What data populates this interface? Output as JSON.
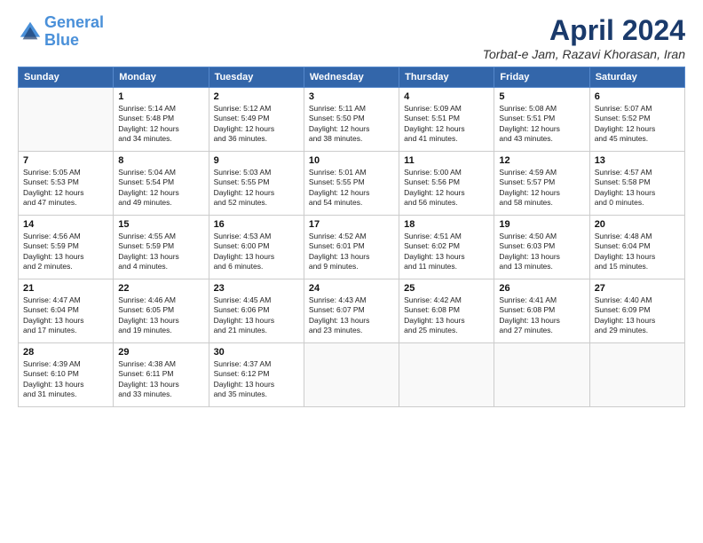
{
  "header": {
    "logo_line1": "General",
    "logo_line2": "Blue",
    "main_title": "April 2024",
    "subtitle": "Torbat-e Jam, Razavi Khorasan, Iran"
  },
  "weekdays": [
    "Sunday",
    "Monday",
    "Tuesday",
    "Wednesday",
    "Thursday",
    "Friday",
    "Saturday"
  ],
  "weeks": [
    [
      {
        "day": "",
        "info": ""
      },
      {
        "day": "1",
        "info": "Sunrise: 5:14 AM\nSunset: 5:48 PM\nDaylight: 12 hours\nand 34 minutes."
      },
      {
        "day": "2",
        "info": "Sunrise: 5:12 AM\nSunset: 5:49 PM\nDaylight: 12 hours\nand 36 minutes."
      },
      {
        "day": "3",
        "info": "Sunrise: 5:11 AM\nSunset: 5:50 PM\nDaylight: 12 hours\nand 38 minutes."
      },
      {
        "day": "4",
        "info": "Sunrise: 5:09 AM\nSunset: 5:51 PM\nDaylight: 12 hours\nand 41 minutes."
      },
      {
        "day": "5",
        "info": "Sunrise: 5:08 AM\nSunset: 5:51 PM\nDaylight: 12 hours\nand 43 minutes."
      },
      {
        "day": "6",
        "info": "Sunrise: 5:07 AM\nSunset: 5:52 PM\nDaylight: 12 hours\nand 45 minutes."
      }
    ],
    [
      {
        "day": "7",
        "info": "Sunrise: 5:05 AM\nSunset: 5:53 PM\nDaylight: 12 hours\nand 47 minutes."
      },
      {
        "day": "8",
        "info": "Sunrise: 5:04 AM\nSunset: 5:54 PM\nDaylight: 12 hours\nand 49 minutes."
      },
      {
        "day": "9",
        "info": "Sunrise: 5:03 AM\nSunset: 5:55 PM\nDaylight: 12 hours\nand 52 minutes."
      },
      {
        "day": "10",
        "info": "Sunrise: 5:01 AM\nSunset: 5:55 PM\nDaylight: 12 hours\nand 54 minutes."
      },
      {
        "day": "11",
        "info": "Sunrise: 5:00 AM\nSunset: 5:56 PM\nDaylight: 12 hours\nand 56 minutes."
      },
      {
        "day": "12",
        "info": "Sunrise: 4:59 AM\nSunset: 5:57 PM\nDaylight: 12 hours\nand 58 minutes."
      },
      {
        "day": "13",
        "info": "Sunrise: 4:57 AM\nSunset: 5:58 PM\nDaylight: 13 hours\nand 0 minutes."
      }
    ],
    [
      {
        "day": "14",
        "info": "Sunrise: 4:56 AM\nSunset: 5:59 PM\nDaylight: 13 hours\nand 2 minutes."
      },
      {
        "day": "15",
        "info": "Sunrise: 4:55 AM\nSunset: 5:59 PM\nDaylight: 13 hours\nand 4 minutes."
      },
      {
        "day": "16",
        "info": "Sunrise: 4:53 AM\nSunset: 6:00 PM\nDaylight: 13 hours\nand 6 minutes."
      },
      {
        "day": "17",
        "info": "Sunrise: 4:52 AM\nSunset: 6:01 PM\nDaylight: 13 hours\nand 9 minutes."
      },
      {
        "day": "18",
        "info": "Sunrise: 4:51 AM\nSunset: 6:02 PM\nDaylight: 13 hours\nand 11 minutes."
      },
      {
        "day": "19",
        "info": "Sunrise: 4:50 AM\nSunset: 6:03 PM\nDaylight: 13 hours\nand 13 minutes."
      },
      {
        "day": "20",
        "info": "Sunrise: 4:48 AM\nSunset: 6:04 PM\nDaylight: 13 hours\nand 15 minutes."
      }
    ],
    [
      {
        "day": "21",
        "info": "Sunrise: 4:47 AM\nSunset: 6:04 PM\nDaylight: 13 hours\nand 17 minutes."
      },
      {
        "day": "22",
        "info": "Sunrise: 4:46 AM\nSunset: 6:05 PM\nDaylight: 13 hours\nand 19 minutes."
      },
      {
        "day": "23",
        "info": "Sunrise: 4:45 AM\nSunset: 6:06 PM\nDaylight: 13 hours\nand 21 minutes."
      },
      {
        "day": "24",
        "info": "Sunrise: 4:43 AM\nSunset: 6:07 PM\nDaylight: 13 hours\nand 23 minutes."
      },
      {
        "day": "25",
        "info": "Sunrise: 4:42 AM\nSunset: 6:08 PM\nDaylight: 13 hours\nand 25 minutes."
      },
      {
        "day": "26",
        "info": "Sunrise: 4:41 AM\nSunset: 6:08 PM\nDaylight: 13 hours\nand 27 minutes."
      },
      {
        "day": "27",
        "info": "Sunrise: 4:40 AM\nSunset: 6:09 PM\nDaylight: 13 hours\nand 29 minutes."
      }
    ],
    [
      {
        "day": "28",
        "info": "Sunrise: 4:39 AM\nSunset: 6:10 PM\nDaylight: 13 hours\nand 31 minutes."
      },
      {
        "day": "29",
        "info": "Sunrise: 4:38 AM\nSunset: 6:11 PM\nDaylight: 13 hours\nand 33 minutes."
      },
      {
        "day": "30",
        "info": "Sunrise: 4:37 AM\nSunset: 6:12 PM\nDaylight: 13 hours\nand 35 minutes."
      },
      {
        "day": "",
        "info": ""
      },
      {
        "day": "",
        "info": ""
      },
      {
        "day": "",
        "info": ""
      },
      {
        "day": "",
        "info": ""
      }
    ]
  ]
}
